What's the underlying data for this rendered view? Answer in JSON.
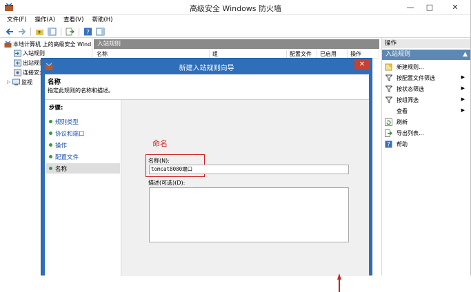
{
  "window": {
    "title": "高级安全 Windows 防火墙",
    "minimize": "—",
    "maximize": "□",
    "close": "✕"
  },
  "menu": [
    "文件(F)",
    "操作(A)",
    "查看(V)",
    "帮助(H)"
  ],
  "tree": {
    "root": "本地计算机 上的高级安全 Wind",
    "items": [
      "入站规则",
      "出站规则",
      "连接安全",
      "监视"
    ]
  },
  "center": {
    "header": "入站规则",
    "columns": [
      "名称",
      "组",
      "配置文件",
      "已启用",
      "操作"
    ]
  },
  "actions": {
    "header": "操作",
    "section": "入站规则",
    "items": [
      {
        "label": "新建规则...",
        "arrow": false
      },
      {
        "label": "按配置文件筛选",
        "arrow": true
      },
      {
        "label": "按状态筛选",
        "arrow": true
      },
      {
        "label": "按组筛选",
        "arrow": true
      },
      {
        "label": "查看",
        "arrow": true
      },
      {
        "label": "刷新",
        "arrow": false
      },
      {
        "label": "导出列表...",
        "arrow": false
      },
      {
        "label": "帮助",
        "arrow": false
      }
    ]
  },
  "dialog": {
    "title": "新建入站规则向导",
    "close": "✕",
    "header_title": "名称",
    "header_subtitle": "指定此规则的名称和描述。",
    "steps_title": "步骤:",
    "steps": [
      "规则类型",
      "协议和端口",
      "操作",
      "配置文件",
      "名称"
    ],
    "annotation": "命名",
    "name_label": "名称(N):",
    "name_value": "tomcat8080端口",
    "desc_label": "描述(可选)(D):"
  },
  "colors": {
    "dialog_frame": "#2f6fb9",
    "action_section": "#5e88b4",
    "annotation": "#d02020",
    "close_button": "#c84031"
  }
}
